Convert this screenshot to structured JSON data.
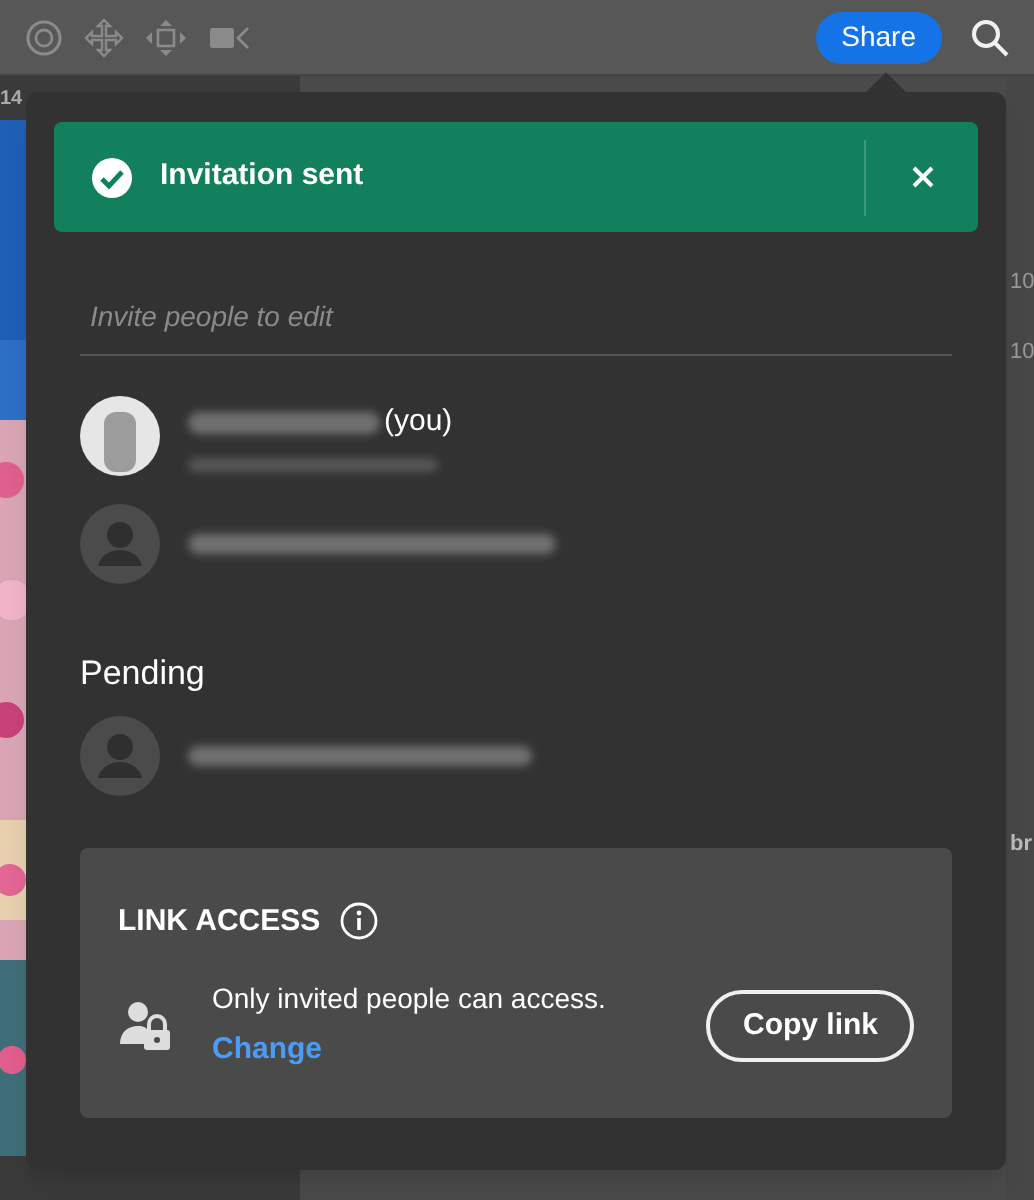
{
  "toolbar": {
    "share_button": "Share"
  },
  "background": {
    "corner_label": "14",
    "side_labels": [
      "10",
      "10",
      "br"
    ]
  },
  "share_dialog": {
    "toast": {
      "message": "Invitation sent"
    },
    "invite_field": {
      "placeholder": "Invite people to edit"
    },
    "people": [
      {
        "suffix": "(you)"
      },
      {
        "kind": "generic"
      }
    ],
    "pending_label": "Pending",
    "pending": [
      {
        "kind": "generic"
      }
    ],
    "link_access": {
      "title": "LINK ACCESS",
      "description": "Only invited people can access.",
      "change_link": "Change",
      "copy_button": "Copy link"
    }
  }
}
